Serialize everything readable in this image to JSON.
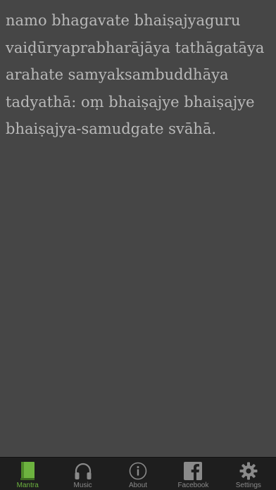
{
  "mantra": {
    "lines": [
      "namo bhagavate bhaiṣajyaguru",
      "vaiḍūryaprabharājāya tathāgatāya",
      "arahate samyaksambuddhāya",
      "tadyathā: oṃ bhaiṣajye bhaiṣajye",
      "bhaiṣajya-samudgate svāhā."
    ]
  },
  "tabbar": {
    "active_tab": "Mantra",
    "tabs": [
      {
        "label": "Mantra",
        "icon": "book-icon"
      },
      {
        "label": "Music",
        "icon": "headphones-icon"
      },
      {
        "label": "About",
        "icon": "info-icon"
      },
      {
        "label": "Facebook",
        "icon": "facebook-icon"
      },
      {
        "label": "Settings",
        "icon": "gear-icon"
      }
    ]
  },
  "colors": {
    "background": "#464646",
    "text": "#b9b9b9",
    "tabbar": "#1e1e1e",
    "active": "#6db33f",
    "inactive": "#8a8a8a"
  }
}
